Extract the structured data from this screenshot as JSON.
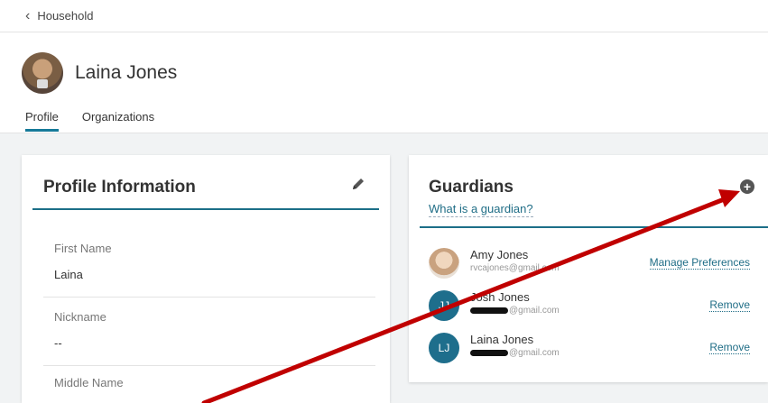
{
  "topbar": {
    "back_label": "Household"
  },
  "profile": {
    "name": "Laina Jones"
  },
  "tabs": [
    {
      "label": "Profile",
      "active": true
    },
    {
      "label": "Organizations",
      "active": false
    }
  ],
  "profile_card": {
    "title": "Profile Information",
    "fields": [
      {
        "label": "First Name",
        "value": "Laina"
      },
      {
        "label": "Nickname",
        "value": "--"
      },
      {
        "label": "Middle Name",
        "value": ""
      }
    ]
  },
  "guardians_card": {
    "title": "Guardians",
    "help_link": "What is a guardian?",
    "guardians": [
      {
        "name": "Amy Jones",
        "email": "rvcajones@gmail.com",
        "initials": "",
        "action": "Manage Preferences"
      },
      {
        "name": "Josh Jones",
        "email": "@gmail.com",
        "initials": "JJ",
        "action": "Remove"
      },
      {
        "name": "Laina Jones",
        "email": "@gmail.com",
        "initials": "LJ",
        "action": "Remove"
      }
    ]
  },
  "colors": {
    "accent": "#1c6f88",
    "annotation_arrow": "#c00000"
  }
}
